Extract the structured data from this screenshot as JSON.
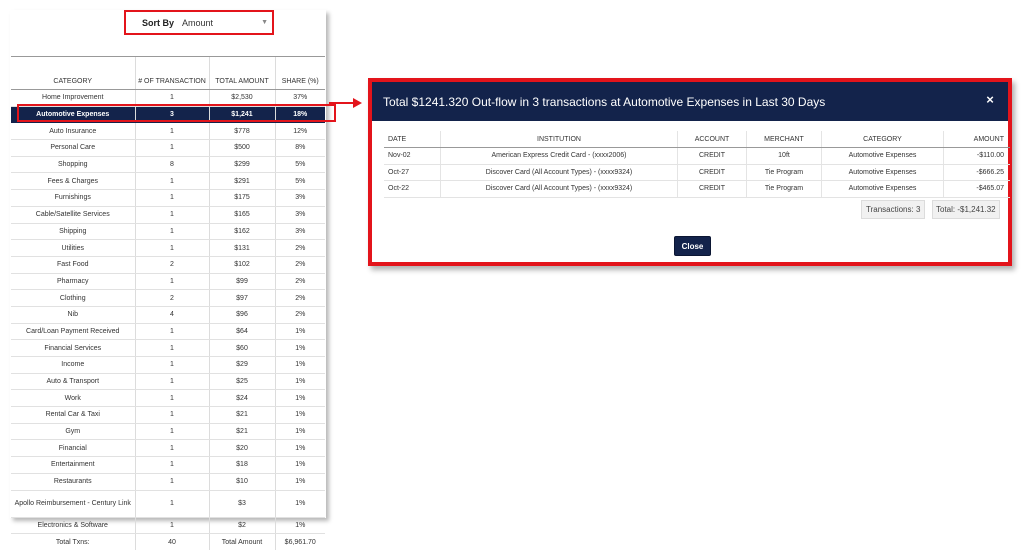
{
  "sort": {
    "label": "Sort By",
    "selected": "Amount"
  },
  "category_table": {
    "headers": [
      "CATEGORY",
      "# OF TRANSACTION",
      "TOTAL AMOUNT",
      "SHARE (%)"
    ],
    "rows": [
      [
        "Home Improvement",
        "1",
        "$2,530",
        "37%"
      ],
      [
        "Automotive Expenses",
        "3",
        "$1,241",
        "18%"
      ],
      [
        "Auto Insurance",
        "1",
        "$778",
        "12%"
      ],
      [
        "Personal Care",
        "1",
        "$500",
        "8%"
      ],
      [
        "Shopping",
        "8",
        "$299",
        "5%"
      ],
      [
        "Fees & Charges",
        "1",
        "$291",
        "5%"
      ],
      [
        "Furnishings",
        "1",
        "$175",
        "3%"
      ],
      [
        "Cable/Satellite Services",
        "1",
        "$165",
        "3%"
      ],
      [
        "Shipping",
        "1",
        "$162",
        "3%"
      ],
      [
        "Utilities",
        "1",
        "$131",
        "2%"
      ],
      [
        "Fast Food",
        "2",
        "$102",
        "2%"
      ],
      [
        "Pharmacy",
        "1",
        "$99",
        "2%"
      ],
      [
        "Clothing",
        "2",
        "$97",
        "2%"
      ],
      [
        "Nib",
        "4",
        "$96",
        "2%"
      ],
      [
        "Card/Loan Payment Received",
        "1",
        "$64",
        "1%"
      ],
      [
        "Financial Services",
        "1",
        "$60",
        "1%"
      ],
      [
        "Income",
        "1",
        "$29",
        "1%"
      ],
      [
        "Auto & Transport",
        "1",
        "$25",
        "1%"
      ],
      [
        "Work",
        "1",
        "$24",
        "1%"
      ],
      [
        "Rental Car & Taxi",
        "1",
        "$21",
        "1%"
      ],
      [
        "Gym",
        "1",
        "$21",
        "1%"
      ],
      [
        "Financial",
        "1",
        "$20",
        "1%"
      ],
      [
        "Entertainment",
        "1",
        "$18",
        "1%"
      ],
      [
        "Restaurants",
        "1",
        "$10",
        "1%"
      ],
      [
        "Apollo Reimbursement - Century Link",
        "1",
        "$3",
        "1%"
      ],
      [
        "Electronics & Software",
        "1",
        "$2",
        "1%"
      ]
    ],
    "selected_index": 1,
    "total_row": [
      "Total Txns:",
      "40",
      "Total Amount",
      "$6,961.70"
    ]
  },
  "modal": {
    "title": "Total $1241.320 Out-flow in 3 transactions at Automotive Expenses in Last 30 Days",
    "close_icon": "×",
    "headers": [
      "DATE",
      "INSTITUTION",
      "ACCOUNT",
      "MERCHANT",
      "CATEGORY",
      "AMOUNT"
    ],
    "rows": [
      [
        "Nov-02",
        "American Express Credit Card - (xxxx2006)",
        "CREDIT",
        "10ft",
        "Automotive Expenses",
        "-$110.00"
      ],
      [
        "Oct-27",
        "Discover Card (All Account Types) - (xxxx9324)",
        "CREDIT",
        "Tie Program",
        "Automotive Expenses",
        "-$666.25"
      ],
      [
        "Oct-22",
        "Discover Card (All Account Types) - (xxxx9324)",
        "CREDIT",
        "Tie Program",
        "Automotive Expenses",
        "-$465.07"
      ]
    ],
    "transactions_count": "Transactions: 3",
    "total": "Total: -$1,241.32",
    "close_button": "Close"
  },
  "colors": {
    "navy": "#13234b",
    "highlight_red": "#e3141b"
  },
  "icons": {
    "dropdown": "chevron-down-icon",
    "close": "close-icon",
    "arrow": "arrow-right-icon"
  }
}
